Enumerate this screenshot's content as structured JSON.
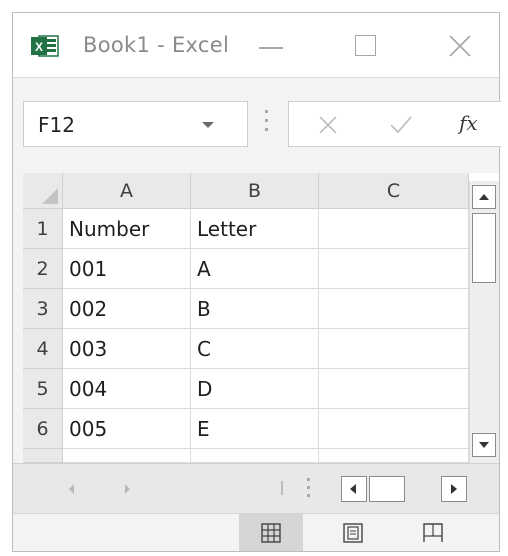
{
  "window": {
    "title": "Book1 - Excel",
    "app_logo_letter": "X",
    "brand_color": "#217346"
  },
  "formula_bar": {
    "name_box": "F12",
    "function_label": "fx",
    "formula_value": ""
  },
  "grid": {
    "columns": [
      "A",
      "B",
      "C"
    ],
    "rows": [
      {
        "num": "1",
        "cells": [
          "Number",
          "Letter",
          ""
        ]
      },
      {
        "num": "2",
        "cells": [
          "001",
          "A",
          ""
        ]
      },
      {
        "num": "3",
        "cells": [
          "002",
          "B",
          ""
        ]
      },
      {
        "num": "4",
        "cells": [
          "003",
          "C",
          ""
        ]
      },
      {
        "num": "5",
        "cells": [
          "004",
          "D",
          ""
        ]
      },
      {
        "num": "6",
        "cells": [
          "005",
          "E",
          ""
        ]
      }
    ]
  },
  "status_bar": {
    "views": [
      "normal-view-icon",
      "page-layout-view-icon",
      "page-break-preview-icon"
    ],
    "active_view": "normal-view-icon"
  }
}
